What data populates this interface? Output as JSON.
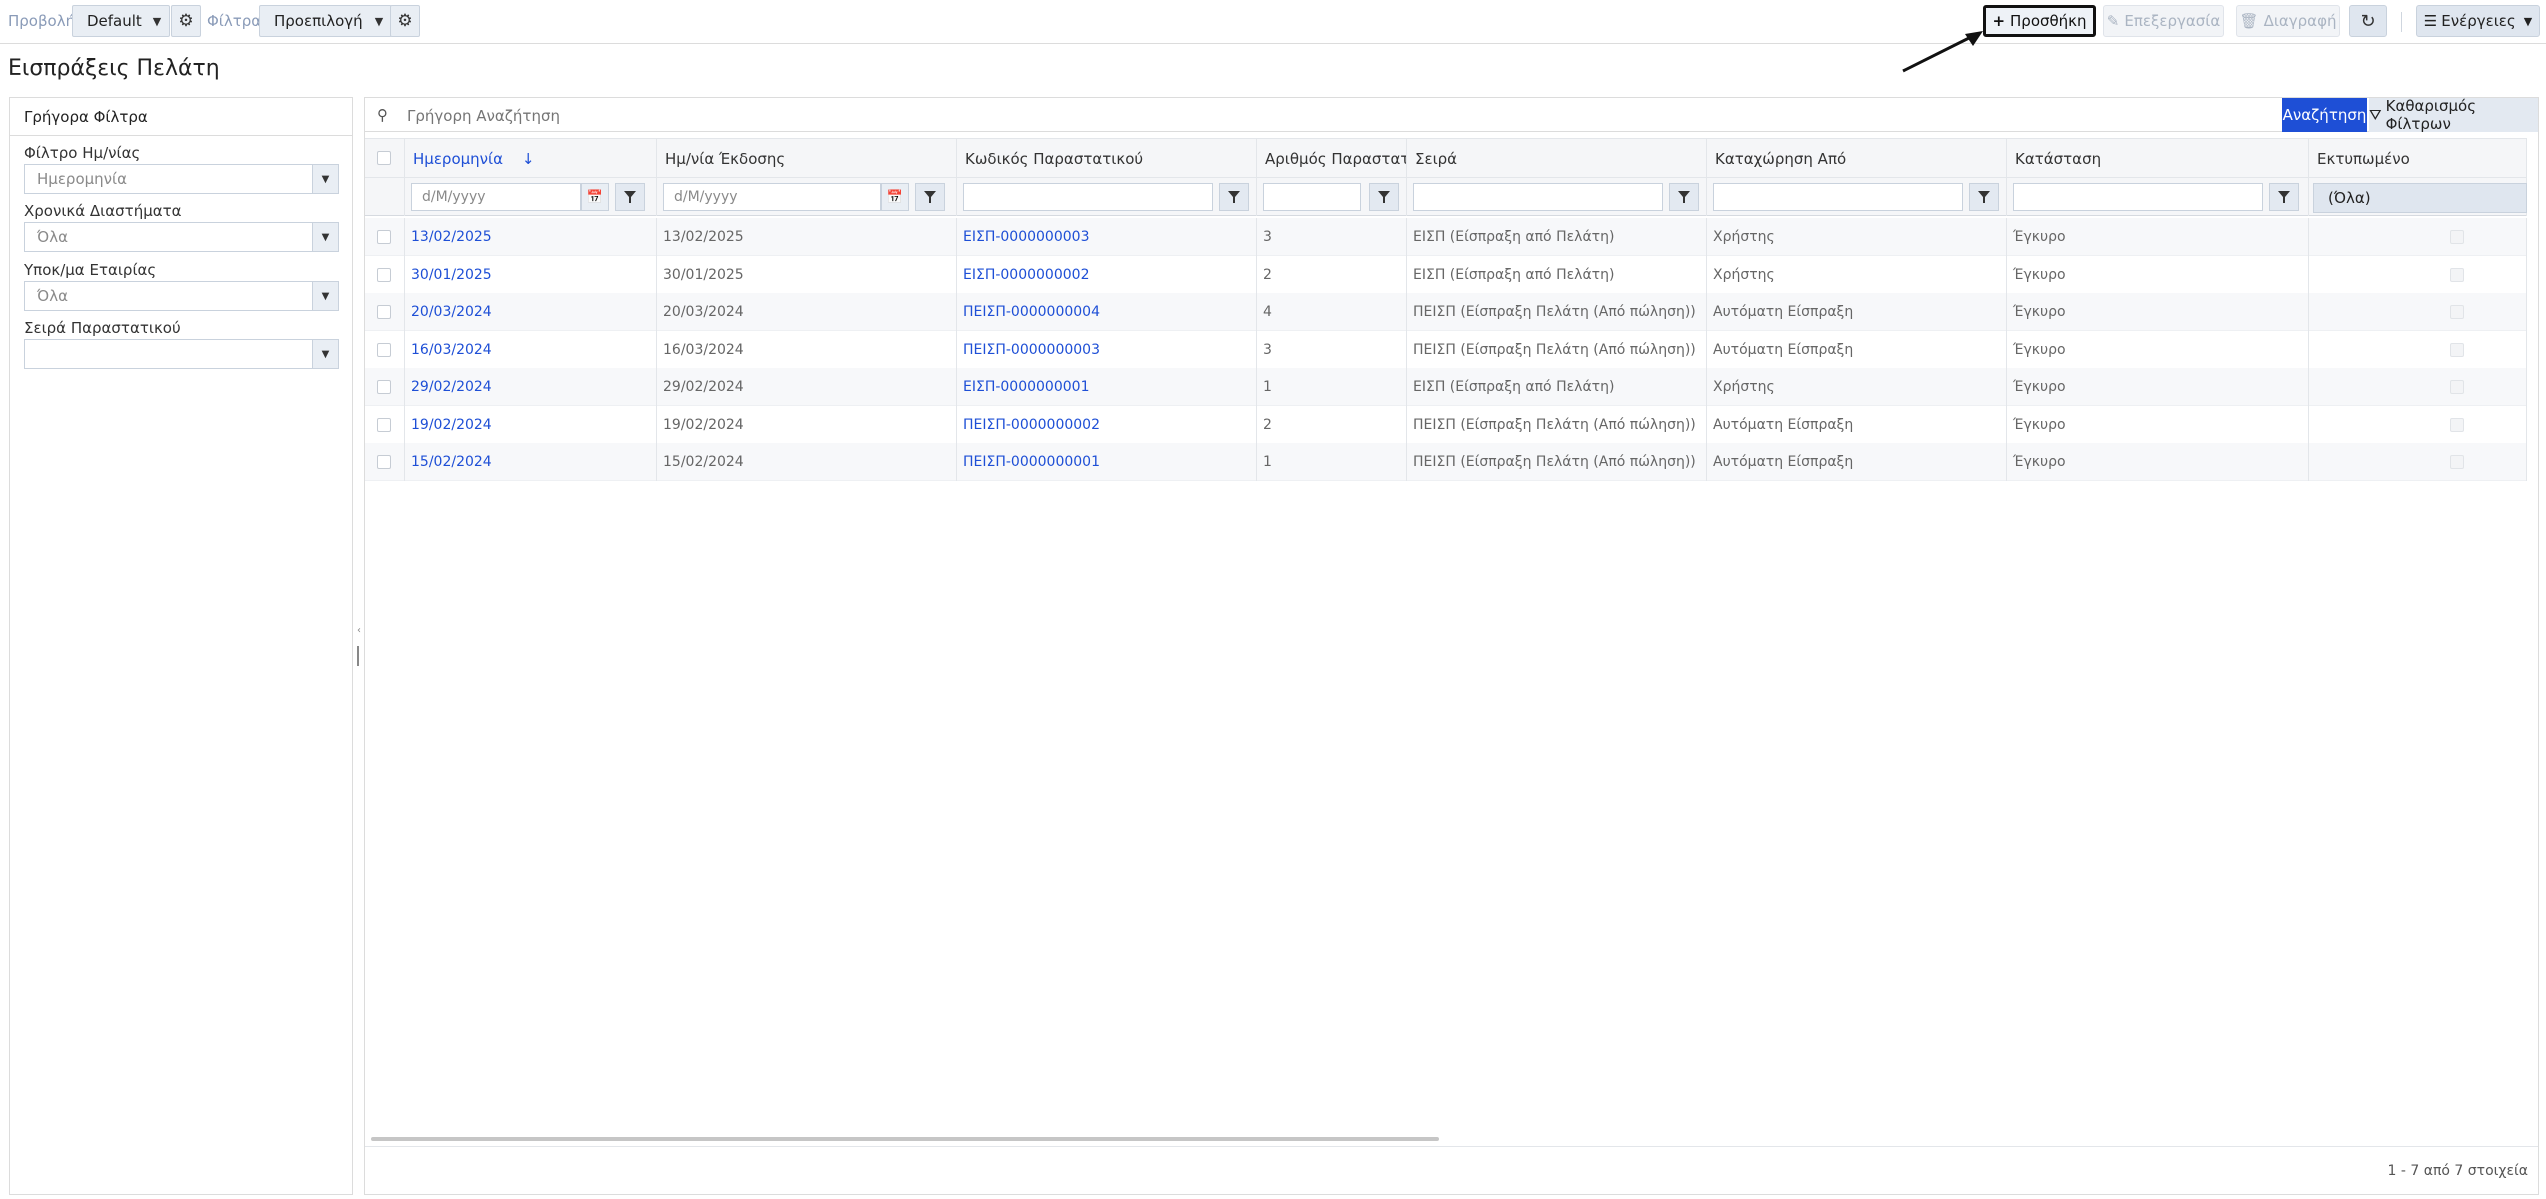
{
  "toolbar": {
    "view_label": "Προβολή",
    "view_value": "Default",
    "filters_label": "Φίλτρα",
    "filters_value": "Προεπιλογή",
    "add_label": "Προσθήκη",
    "edit_label": "Επεξεργασία",
    "delete_label": "Διαγραφή",
    "actions_label": "Ενέργειες"
  },
  "page": {
    "title": "Εισπράξεις Πελάτη"
  },
  "quick_filters": {
    "title": "Γρήγορα Φίλτρα",
    "fields": [
      {
        "label": "Φίλτρο Ημ/νίας",
        "value": "Ημερομηνία"
      },
      {
        "label": "Χρονικά Διαστήματα",
        "value": "Όλα"
      },
      {
        "label": "Υποκ/μα Εταιρίας",
        "value": "Όλα"
      },
      {
        "label": "Σειρά Παραστατικού",
        "value": ""
      }
    ]
  },
  "search": {
    "placeholder": "Γρήγορη Αναζήτηση",
    "search_button": "Αναζήτηση",
    "clear_button": "Καθαρισμός Φίλτρων"
  },
  "grid": {
    "columns": [
      {
        "label": "Ημερομηνία",
        "sorted": true,
        "sort_icon": "arrow-down-icon"
      },
      {
        "label": "Ημ/νία Έκδοσης"
      },
      {
        "label": "Κωδικός Παραστατικού"
      },
      {
        "label": "Αριθμός Παραστατ..."
      },
      {
        "label": "Σειρά"
      },
      {
        "label": "Καταχώρηση Από"
      },
      {
        "label": "Κατάσταση"
      },
      {
        "label": "Εκτυπωμένο"
      }
    ],
    "filters": {
      "date_placeholder": "d/M/yyyy",
      "issue_date_placeholder": "d/M/yyyy",
      "printed_value": "(Όλα)"
    },
    "rows": [
      {
        "date": "13/02/2025",
        "issue_date": "13/02/2025",
        "code": "ΕΙΣΠ-0000000003",
        "number": "3",
        "series": "ΕΙΣΠ (Είσπραξη από Πελάτη)",
        "entered_by": "Χρήστης",
        "status": "Έγκυρο"
      },
      {
        "date": "30/01/2025",
        "issue_date": "30/01/2025",
        "code": "ΕΙΣΠ-0000000002",
        "number": "2",
        "series": "ΕΙΣΠ (Είσπραξη από Πελάτη)",
        "entered_by": "Χρήστης",
        "status": "Έγκυρο"
      },
      {
        "date": "20/03/2024",
        "issue_date": "20/03/2024",
        "code": "ΠΕΙΣΠ-0000000004",
        "number": "4",
        "series": "ΠΕΙΣΠ (Είσπραξη Πελάτη (Από πώληση))",
        "entered_by": "Αυτόματη Είσπραξη",
        "status": "Έγκυρο"
      },
      {
        "date": "16/03/2024",
        "issue_date": "16/03/2024",
        "code": "ΠΕΙΣΠ-0000000003",
        "number": "3",
        "series": "ΠΕΙΣΠ (Είσπραξη Πελάτη (Από πώληση))",
        "entered_by": "Αυτόματη Είσπραξη",
        "status": "Έγκυρο"
      },
      {
        "date": "29/02/2024",
        "issue_date": "29/02/2024",
        "code": "ΕΙΣΠ-0000000001",
        "number": "1",
        "series": "ΕΙΣΠ (Είσπραξη από Πελάτη)",
        "entered_by": "Χρήστης",
        "status": "Έγκυρο"
      },
      {
        "date": "19/02/2024",
        "issue_date": "19/02/2024",
        "code": "ΠΕΙΣΠ-0000000002",
        "number": "2",
        "series": "ΠΕΙΣΠ (Είσπραξη Πελάτη (Από πώληση))",
        "entered_by": "Αυτόματη Είσπραξη",
        "status": "Έγκυρο"
      },
      {
        "date": "15/02/2024",
        "issue_date": "15/02/2024",
        "code": "ΠΕΙΣΠ-0000000001",
        "number": "1",
        "series": "ΠΕΙΣΠ (Είσπραξη Πελάτη (Από πώληση))",
        "entered_by": "Αυτόματη Είσπραξη",
        "status": "Έγκυρο"
      }
    ],
    "footer_count": "1 - 7 από 7 στοιχεία"
  }
}
